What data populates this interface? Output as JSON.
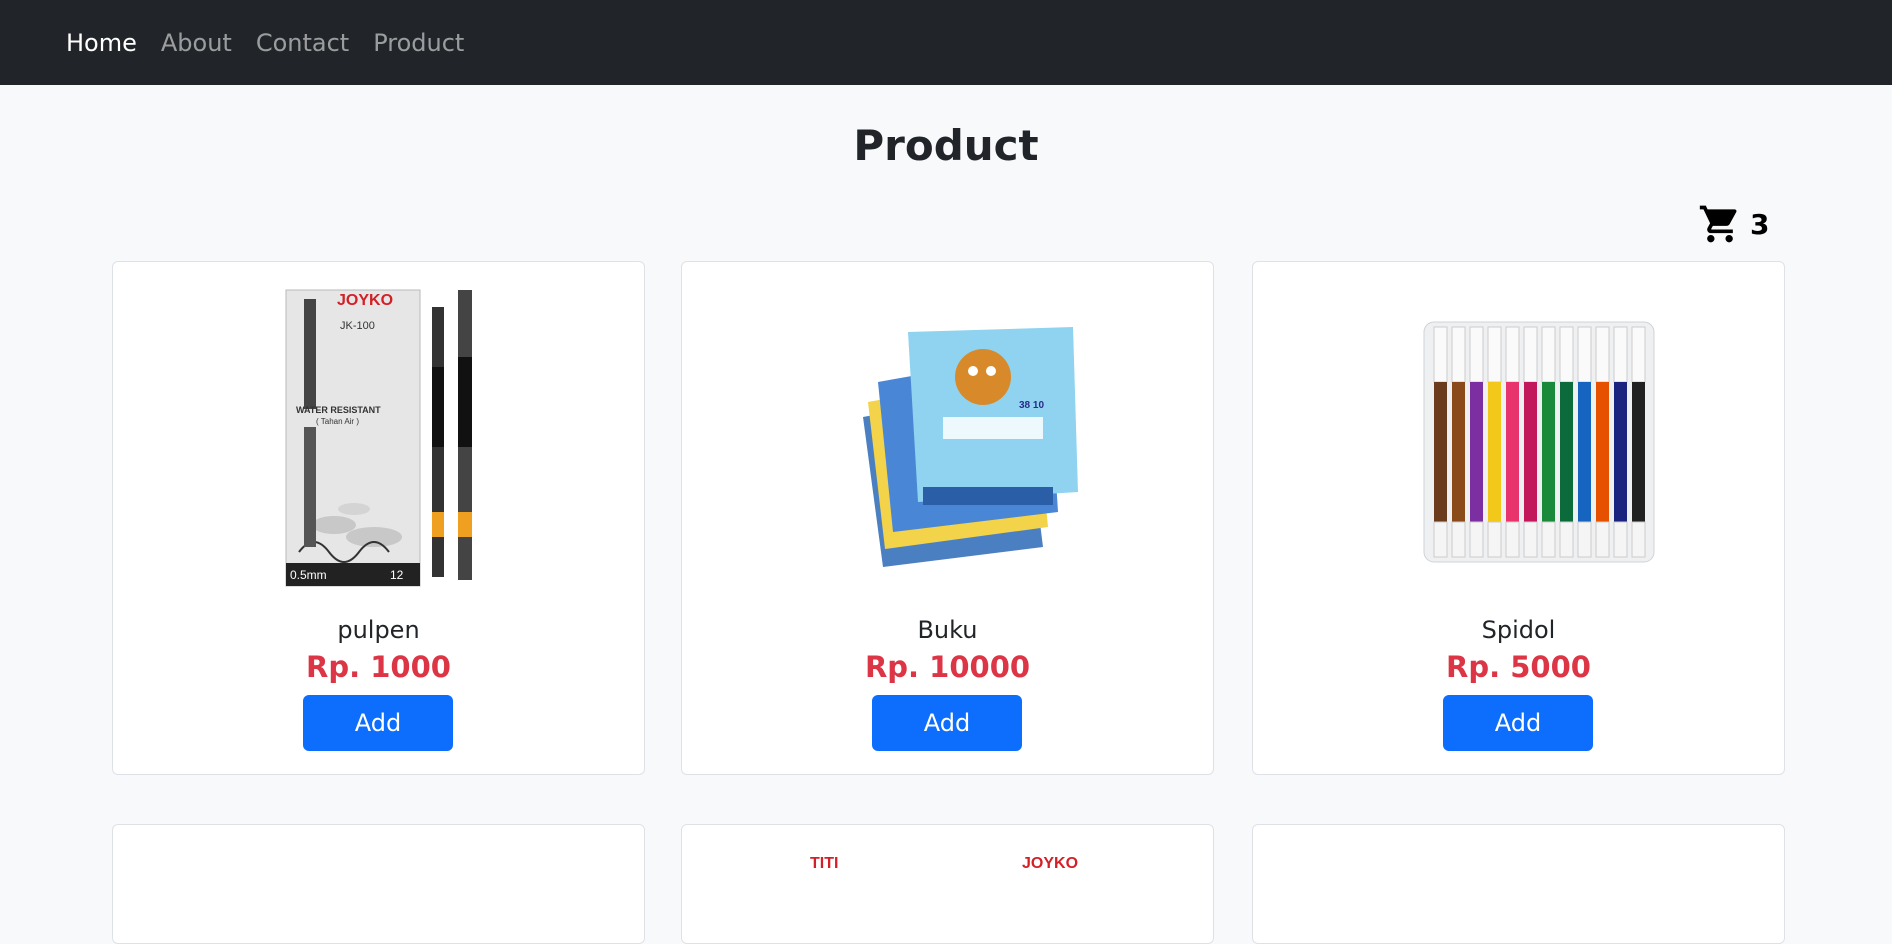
{
  "nav": {
    "items": [
      {
        "label": "Home"
      },
      {
        "label": "About"
      },
      {
        "label": "Contact"
      },
      {
        "label": "Product"
      }
    ]
  },
  "page": {
    "title": "Product"
  },
  "cart": {
    "icon": "cart-icon",
    "count": "3"
  },
  "products": [
    {
      "name": "pulpen",
      "price": "Rp. 1000",
      "button": "Add",
      "image": "pen-box-image",
      "brand": "JOYKO",
      "model": "JK-100",
      "line1": "WATER RESISTANT",
      "line2": "( Tahan Air )",
      "size": "0.5mm",
      "qty": "12"
    },
    {
      "name": "Buku",
      "price": "Rp. 10000",
      "button": "Add",
      "image": "notebook-stack-image",
      "label": "38 10"
    },
    {
      "name": "Spidol",
      "price": "Rp. 5000",
      "button": "Add",
      "image": "markers-image"
    }
  ],
  "row2": [
    {
      "image": "product-image"
    },
    {
      "image": "product-image",
      "brand_left": "TITI",
      "brand_right": "JOYKO"
    },
    {
      "image": "product-image"
    }
  ]
}
